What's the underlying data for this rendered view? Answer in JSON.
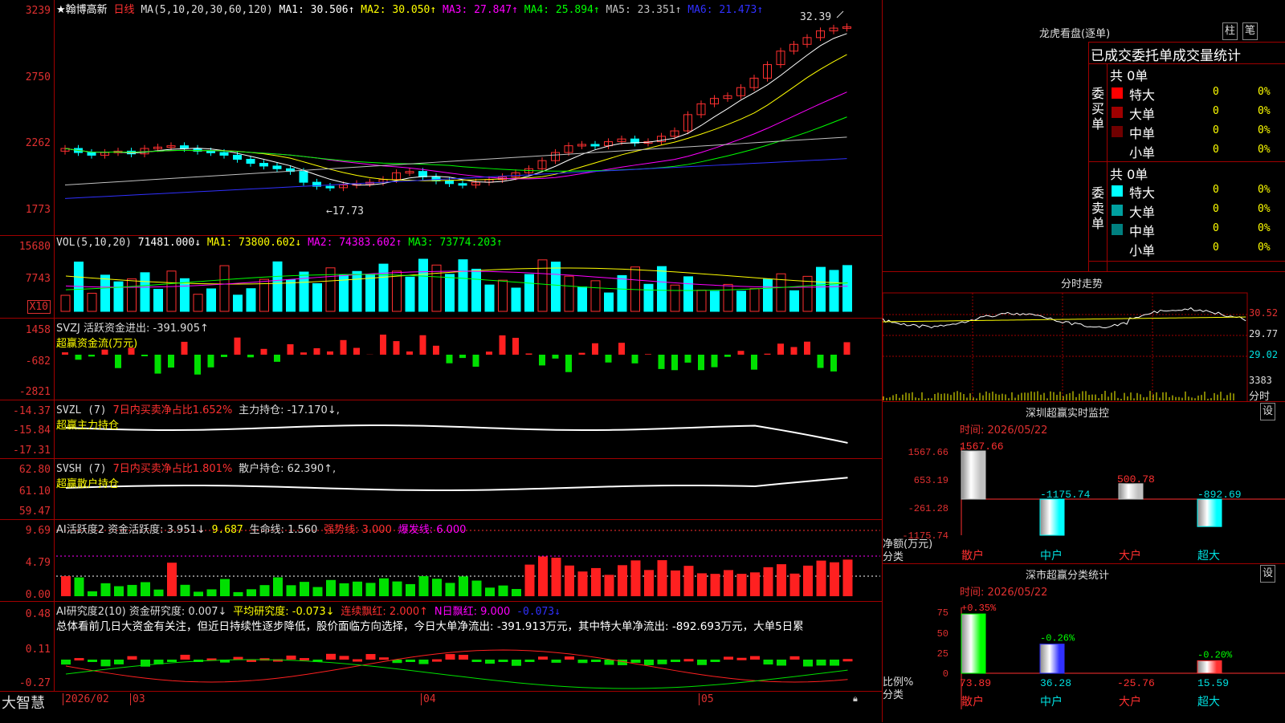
{
  "main": {
    "title": "★翰博高新",
    "period": "日线",
    "ma_label": "MA(5,10,20,30,60,120)",
    "ma_values": [
      {
        "label": "MA1: 30.506↑",
        "color": "#ffffff"
      },
      {
        "label": "MA2: 30.050↑",
        "color": "#ffff00"
      },
      {
        "label": "MA3: 27.847↑",
        "color": "#ff00ff"
      },
      {
        "label": "MA4: 25.894↑",
        "color": "#00ff00"
      },
      {
        "label": "MA5: 23.351↑",
        "color": "#c0c0c0"
      },
      {
        "label": "MA6: 21.473↑",
        "color": "#3030ff"
      }
    ],
    "yticks": [
      "3239",
      "2750",
      "2262",
      "1773"
    ],
    "high_label": "32.39",
    "low_label": "←17.73"
  },
  "vol": {
    "header": "VOL(5,10,20)",
    "value": "71481.000↓",
    "ma1": "MA1: 73800.602↓",
    "ma2": "MA2: 74383.602↑",
    "ma3": "MA3: 73774.203↑",
    "yticks": [
      "15680",
      "7743"
    ],
    "unit": "X10"
  },
  "svzj": {
    "header": "SVZJ  活跃资金进出: -391.905↑",
    "sub": "超赢资金流(万元)",
    "yticks": [
      "1458",
      "-682",
      "-2821"
    ]
  },
  "svzl": {
    "header_a": "SVZL (7)",
    "header_b": "7日内买卖净占比1.652%",
    "header_c": "主力持仓: -17.170↓,",
    "sub": "超赢主力持仓",
    "yticks": [
      "-14.37",
      "-15.84",
      "-17.31"
    ]
  },
  "svsh": {
    "header_a": "SVSH (7)",
    "header_b": "7日内买卖净占比1.801%",
    "header_c": "散户持仓: 62.390↑,",
    "sub": "超赢散户持仓",
    "yticks": [
      "62.80",
      "61.10",
      "59.47"
    ]
  },
  "ai1": {
    "header_a": "AI活跃度2 资金活跃度: 3.951↓",
    "header_b": "9.687",
    "header_c": "生命线: 1.560",
    "header_d": "强势线: 3.000",
    "header_e": "爆发线: 6.000",
    "yticks": [
      "9.69",
      "4.79",
      "0.00"
    ]
  },
  "ai2": {
    "header_a": "AI研究度2(10) 资金研究度: 0.007↓",
    "header_b": "平均研究度: -0.073↓",
    "header_c": "连续飘红: 2.000↑",
    "header_d": "N日飘红: 9.000",
    "header_e": "-0.073↓",
    "text": "总体看前几日大资金有关注，但近日持续性逐步降低，股价面临方向选择，今日大单净流出: -391.913万元，其中特大单净流出: -892.693万元，大单5日累",
    "yticks": [
      "0.48",
      "0.11",
      "-0.27"
    ]
  },
  "footer": {
    "brand": "大智慧",
    "dates": [
      "2026/02",
      "03",
      "04",
      "05"
    ]
  },
  "lhb": {
    "title": "龙虎看盘(逐单)",
    "btn1": "柱",
    "btn2": "笔",
    "tabs": "已成交委托单成交量统计",
    "buy_label": "委买单",
    "sell_label": "委卖单",
    "buy_total": "共 0单",
    "sell_total": "共 0单",
    "buy_rows": [
      {
        "name": "特大",
        "n": "0",
        "p": "0%",
        "color": "#ff0000"
      },
      {
        "name": "大单",
        "n": "0",
        "p": "0%",
        "color": "#a00000"
      },
      {
        "name": "中单",
        "n": "0",
        "p": "0%",
        "color": "#700000"
      },
      {
        "name": "小单",
        "n": "0",
        "p": "0%",
        "color": "#000000"
      }
    ],
    "sell_rows": [
      {
        "name": "特大",
        "n": "0",
        "p": "0%",
        "color": "#00ffff"
      },
      {
        "name": "大单",
        "n": "0",
        "p": "0%",
        "color": "#00a0a0"
      },
      {
        "name": "中单",
        "n": "0",
        "p": "0%",
        "color": "#008080"
      },
      {
        "name": "小单",
        "n": "0",
        "p": "0%",
        "color": "#000000"
      }
    ]
  },
  "fs": {
    "title": "分时走势",
    "yticks": [
      "30.52",
      "29.77",
      "29.02"
    ],
    "vol_tick": "3383",
    "vol_label": "分时"
  },
  "sz": {
    "title": "深圳超赢实时监控",
    "set": "设",
    "time": "时间: 2026/05/22",
    "yticks": [
      "1567.66",
      "653.19",
      "-261.28",
      "-1175.74"
    ],
    "ylabel": "净额(万元)",
    "xlabel": "分类",
    "chart_data": {
      "type": "bar",
      "categories": [
        "散户",
        "中户",
        "大户",
        "超大"
      ],
      "values": [
        1567.66,
        -1175.74,
        500.78,
        -892.69
      ],
      "labels": [
        "1567.66",
        "-1175.74",
        "500.78",
        "-892.69"
      ]
    }
  },
  "ss": {
    "title": "深市超赢分类统计",
    "set": "设",
    "time": "时间: 2026/05/22",
    "yticks": [
      "75",
      "50",
      "25",
      "0"
    ],
    "ylabel": "比例%",
    "xlabel": "分类",
    "chart_data": {
      "type": "bar",
      "categories": [
        "散户",
        "中户",
        "大户",
        "超大"
      ],
      "values": [
        73.89,
        36.28,
        -25.76,
        15.59
      ],
      "diffs": [
        "+0.35%",
        "-0.26%",
        "",
        "-0.20%"
      ],
      "labels": [
        "73.89",
        "36.28",
        "-25.76",
        "15.59"
      ]
    }
  }
}
